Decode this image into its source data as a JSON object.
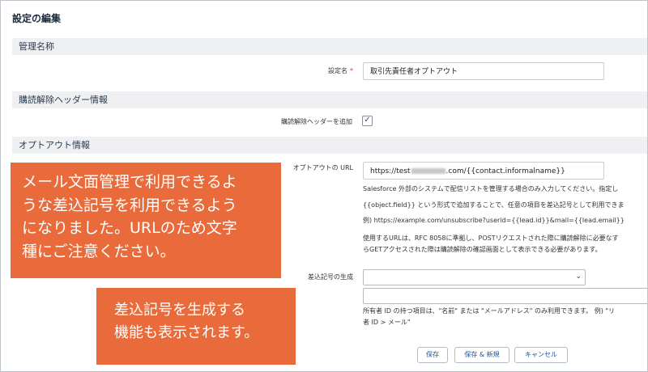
{
  "page_title": "設定の編集",
  "sections": {
    "management_name": "管理名称",
    "unsubscribe_header": "購読解除ヘッダー情報",
    "optout_info": "オプトアウト情報"
  },
  "fields": {
    "setting_name": {
      "label": "設定名",
      "required_mark": "*",
      "value": "取引先責任者オプトアウト"
    },
    "add_header": {
      "label": "購読解除ヘッダーを追加",
      "checked": true,
      "check_glyph": "✓"
    },
    "optout_url": {
      "label": "オプトアウトの URL",
      "value_prefix": "https://test",
      "value_suffix": ".com/{{contact.informalname}}"
    },
    "merge_symbol": {
      "label": "差込記号の生成",
      "selected": ""
    }
  },
  "help": {
    "line1": "Salesforce 外部のシステムで配信リストを管理する場合のみ入力してください。指定し",
    "line2": "{{object.field}} という形式で追加することで、任意の項目を差込記号として利用できま",
    "line3": "例) https://example.com/unsubscribe?userid={{lead.id}}&mail={{lead.email}}",
    "line4": "使用するURLは、RFC 8058に準拠し、POSTリクエストされた際に購読解除に必要なす",
    "line5": "らGETアクセスされた際は購読解除の確認画面として表示できる必要があります。",
    "line6": "所有者 ID の持つ項目は、\"名前\" または \"メールアドレス\" のみ利用できます。 例) \"リ",
    "line7": "者 ID > メール\""
  },
  "buttons": {
    "save": "保存",
    "save_new": "保存 & 新規",
    "cancel": "キャンセル"
  },
  "callouts": {
    "first": [
      "メール文面管理で利用できるよ",
      "うな差込記号を利用できるよう",
      "になりました。URLのため文字",
      "種にご注意ください。"
    ],
    "second": [
      "差込記号を生成する",
      "機能も表示されます。"
    ]
  },
  "colors": {
    "callout": "#e96a3a",
    "section_bg": "#eef0f3",
    "link": "#1b5297",
    "required": "#c23934"
  },
  "icons": {
    "select_chevron": "chevron-down-icon",
    "checkbox_check": "checkmark-icon"
  }
}
